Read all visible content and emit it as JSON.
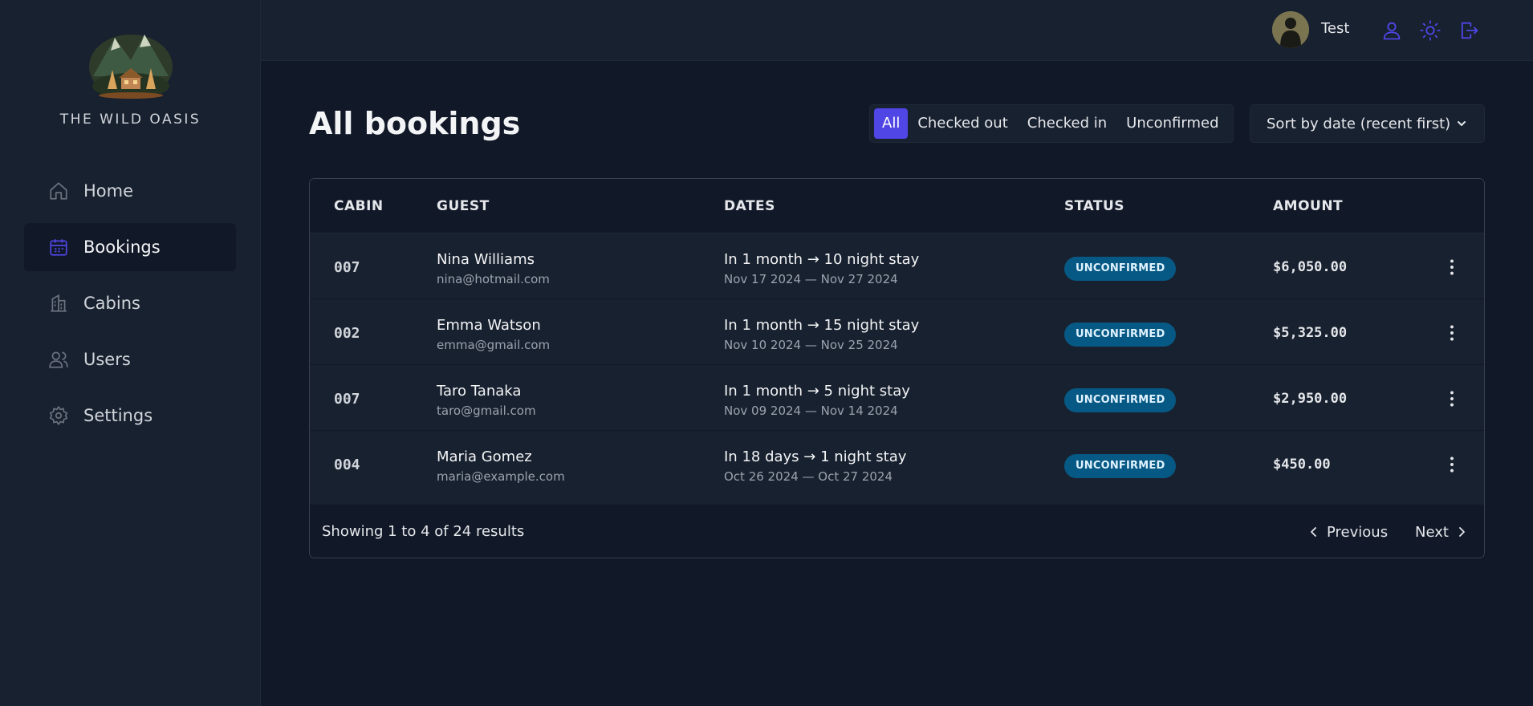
{
  "brand": {
    "name": "THE WILD OASIS"
  },
  "sidebar": {
    "items": [
      {
        "label": "Home",
        "icon": "home-icon"
      },
      {
        "label": "Bookings",
        "icon": "calendar-icon",
        "active": true
      },
      {
        "label": "Cabins",
        "icon": "building-icon"
      },
      {
        "label": "Users",
        "icon": "users-icon"
      },
      {
        "label": "Settings",
        "icon": "gear-icon"
      }
    ]
  },
  "header": {
    "user_name": "Test",
    "buttons": [
      "user-icon",
      "sun-icon",
      "logout-icon"
    ]
  },
  "page": {
    "title": "All bookings",
    "filters": [
      "All",
      "Checked out",
      "Checked in",
      "Unconfirmed"
    ],
    "active_filter": "All",
    "sort_label": "Sort by date (recent first)"
  },
  "table": {
    "headers": [
      "CABIN",
      "GUEST",
      "DATES",
      "STATUS",
      "AMOUNT"
    ],
    "rows": [
      {
        "cabin": "007",
        "guest": "Nina Williams",
        "email": "nina@hotmail.com",
        "stay": "In 1 month → 10 night stay",
        "dates": "Nov 17 2024 — Nov 27 2024",
        "status": "UNCONFIRMED",
        "amount": "$6,050.00"
      },
      {
        "cabin": "002",
        "guest": "Emma Watson",
        "email": "emma@gmail.com",
        "stay": "In 1 month → 15 night stay",
        "dates": "Nov 10 2024 — Nov 25 2024",
        "status": "UNCONFIRMED",
        "amount": "$5,325.00"
      },
      {
        "cabin": "007",
        "guest": "Taro Tanaka",
        "email": "taro@gmail.com",
        "stay": "In 1 month → 5 night stay",
        "dates": "Nov 09 2024 — Nov 14 2024",
        "status": "UNCONFIRMED",
        "amount": "$2,950.00"
      },
      {
        "cabin": "004",
        "guest": "Maria Gomez",
        "email": "maria@example.com",
        "stay": "In 18 days → 1 night stay",
        "dates": "Oct 26 2024 — Oct 27 2024",
        "status": "UNCONFIRMED",
        "amount": "$450.00"
      }
    ],
    "footer": {
      "results": "Showing 1 to 4 of 24 results",
      "previous": "Previous",
      "next": "Next"
    }
  },
  "colors": {
    "accent": "#4f46e5",
    "badge_bg": "#075985",
    "badge_text": "#e0f2fe"
  }
}
